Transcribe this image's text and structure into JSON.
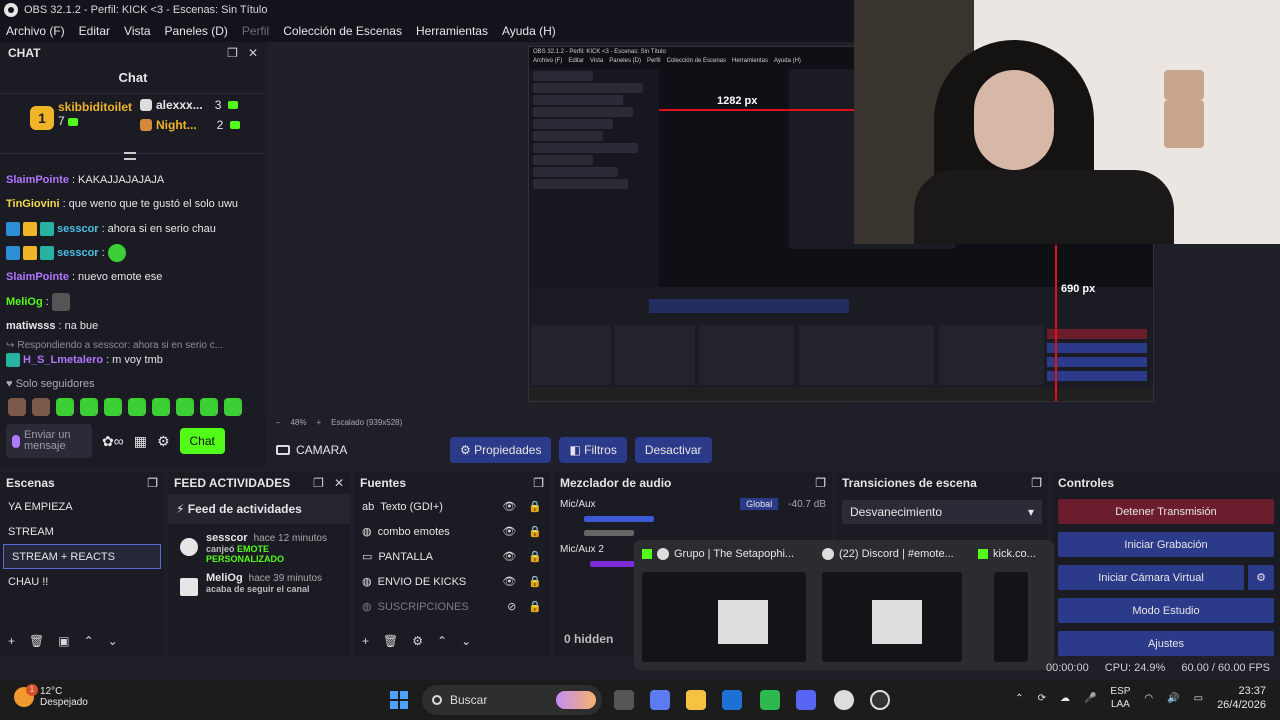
{
  "window_title": "OBS 32.1.2 - Perfil: KICK <3 - Escenas: Sin Título",
  "menu": [
    "Archivo (F)",
    "Editar",
    "Vista",
    "Paneles (D)",
    "Perfil",
    "Colección de Escenas",
    "Herramientas",
    "Ayuda (H)"
  ],
  "chat": {
    "dock_title": "CHAT",
    "title": "Chat",
    "leaderboard": [
      {
        "rank": "1",
        "name": "skibbiditoilet",
        "points": "7"
      },
      {
        "rank": "2",
        "name": "alexxx...",
        "points": "3"
      },
      {
        "rank": "3",
        "name": "Night...",
        "points": "2"
      }
    ],
    "messages": [
      {
        "user": "SlaimPointe",
        "text": "KAKAJJAJAJAJA",
        "color": "purple"
      },
      {
        "user": "TinGiovini",
        "text": "que weno que te gustó el solo uwu",
        "color": "yellow"
      },
      {
        "user": "sesscor",
        "text": "ahora si en serio chau",
        "color": "blue"
      },
      {
        "user": "sesscor",
        "text": "",
        "color": "blue"
      },
      {
        "user": "SlaimPointe",
        "text": "nuevo emote ese",
        "color": "purple"
      },
      {
        "user": "MeliOg",
        "text": "",
        "color": "green"
      },
      {
        "user": "matiwsss",
        "text": "na bue",
        "color": "white"
      },
      {
        "user": "H_S_Lmetalero",
        "text": "m voy tmb",
        "color": "purple"
      }
    ],
    "reply_hint": "Respondiendo a sesscor: ahora si en serio c...",
    "followers_only": "Solo seguidores",
    "input_placeholder": "Enviar un mensaje",
    "send_label": "Chat"
  },
  "nested_preview": {
    "title": "OBS 32.1.2 - Perfil: KICK <3 - Escenas: Sin Título",
    "width_label": "1282 px",
    "height_label": "690 px"
  },
  "preview": {
    "zoom": "48%",
    "scaling": "Escalado (939x528)"
  },
  "source_bar": {
    "selected_source": "CAMARA",
    "properties": "Propiedades",
    "filters": "Filtros",
    "deactivate": "Desactivar"
  },
  "scenes": {
    "title": "Escenas",
    "items": [
      "YA EMPIEZA",
      "STREAM",
      "STREAM + REACTS",
      "CHAU !!"
    ],
    "selected": 2
  },
  "feed": {
    "title": "FEED ACTIVIDADES",
    "header": "Feed de actividades",
    "items": [
      {
        "name": "sesscor",
        "time": "hace 12 minutos",
        "text": "canjeó",
        "highlight": "EMOTE PERSONALIZADO"
      },
      {
        "name": "MeliOg",
        "time": "hace 39 minutos",
        "text": "acaba de seguir el canal",
        "highlight": ""
      }
    ]
  },
  "sources": {
    "title": "Fuentes",
    "items": [
      {
        "name": "Texto (GDI+)",
        "icon": "text-icon",
        "dim": false
      },
      {
        "name": "combo emotes",
        "icon": "browser-icon",
        "dim": false
      },
      {
        "name": "PANTALLA",
        "icon": "display-icon",
        "dim": false
      },
      {
        "name": "ENVIO DE KICKS",
        "icon": "browser-icon",
        "dim": false
      },
      {
        "name": "SUSCRIPCIONES",
        "icon": "browser-icon",
        "dim": true
      }
    ]
  },
  "mixer": {
    "title": "Mezclador de audio",
    "channels": [
      {
        "name": "Mic/Aux",
        "mode": "Global",
        "level": "-40.7 dB"
      },
      {
        "name": "Mic/Aux 2",
        "mode": "",
        "level": ""
      }
    ],
    "hidden": "0 hidden"
  },
  "transitions": {
    "title": "Transiciones de escena",
    "selected": "Desvanecimiento"
  },
  "controls": {
    "title": "Controles",
    "buttons": [
      "Detener Transmisión",
      "Iniciar Grabación",
      "Iniciar Cámara Virtual",
      "Modo Estudio",
      "Ajustes"
    ]
  },
  "tab_preview": [
    {
      "title": "Grupo | The Setapophi..."
    },
    {
      "title": "(22) Discord | #emote..."
    },
    {
      "title": "kick.co..."
    }
  ],
  "status": {
    "time": "00:00:00",
    "cpu": "CPU: 24.9%",
    "fps": "60.00 / 60.00 FPS"
  },
  "taskbar": {
    "weather_temp": "12°C",
    "weather_desc": "Despejado",
    "weather_badge": "1",
    "search": "Buscar",
    "lang1": "ESP",
    "lang2": "LAA",
    "time": "23:37",
    "date": "26/4/2026"
  }
}
